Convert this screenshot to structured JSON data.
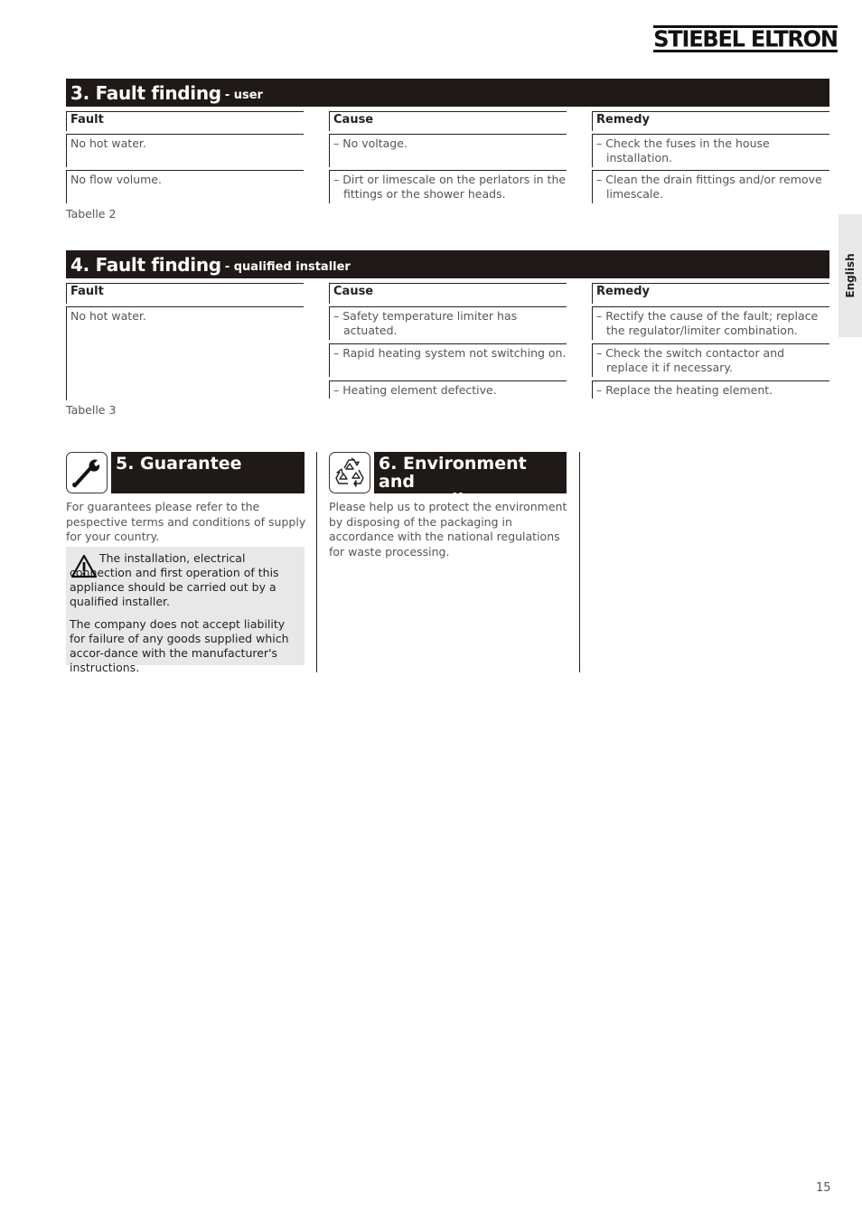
{
  "brand": {
    "logo_text": "STIEBEL ELTRON"
  },
  "side_tab": {
    "label": "English"
  },
  "section3": {
    "title": "3. Fault finding",
    "subtitle": "- user",
    "headers": {
      "fault": "Fault",
      "cause": "Cause",
      "remedy": "Remedy"
    },
    "rows": [
      {
        "fault": "No hot water.",
        "cause": "– No voltage.",
        "remedy": "– Check the fuses in the house installation."
      },
      {
        "fault": "No flow volume.",
        "cause": "– Dirt or limescale on the perlators in the fittings or the shower heads.",
        "remedy": "– Clean the drain fittings and/or remove limescale."
      }
    ],
    "caption": "Tabelle 2"
  },
  "section4": {
    "title": "4. Fault finding",
    "subtitle": "- qualified installer",
    "headers": {
      "fault": "Fault",
      "cause": "Cause",
      "remedy": "Remedy"
    },
    "fault": "No hot water.",
    "rows": [
      {
        "cause": "– Safety temperature limiter has actuated.",
        "remedy": "– Rectify the cause of the fault; replace the regulator/limiter combination."
      },
      {
        "cause": "– Rapid heating system not switching on.",
        "remedy": "– Check the switch contactor and replace it if necessary."
      },
      {
        "cause": "– Heating element defective.",
        "remedy": "– Replace the heating element."
      }
    ],
    "caption": "Tabelle 3"
  },
  "section5": {
    "icon": "wrench-icon",
    "title": "5. Guarantee",
    "body": "For guarantees please refer to the pespective terms and conditions of supply for your country.",
    "warning_icon": "warning-triangle-icon",
    "note_1": "The installation, electrical connection and first operation of this appliance should be carried out by a qualified installer.",
    "note_2": "The company does not accept liability for failure of any goods supplied which accor-dance with the manufacturer's instructions."
  },
  "section6": {
    "icon": "recycling-icon",
    "title_line1": "6. Environment and",
    "title_line2": "recycling",
    "body": "Please help us to protect the environment by disposing of the packaging in accordance with the national regulations for waste processing."
  },
  "footer": {
    "page_number": "15"
  }
}
